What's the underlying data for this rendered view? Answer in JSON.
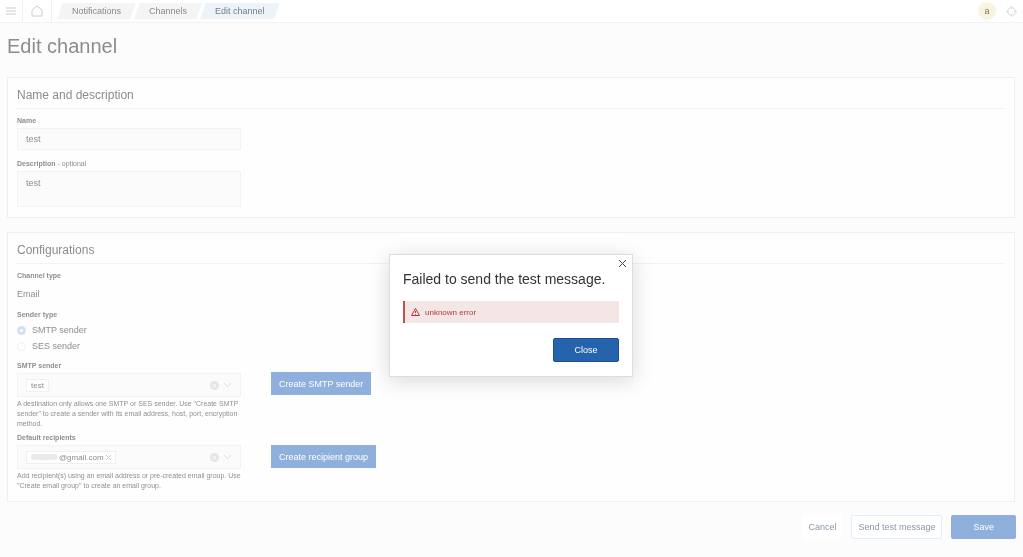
{
  "header": {
    "breadcrumbs": [
      {
        "label": "Notifications",
        "selected": false
      },
      {
        "label": "Channels",
        "selected": false
      },
      {
        "label": "Edit channel",
        "selected": true
      }
    ],
    "avatar": "a"
  },
  "title": "Edit channel",
  "name_section": {
    "title": "Name and description",
    "name_label": "Name",
    "name_value": "test",
    "description_label": "Description",
    "description_optional": "- optional",
    "description_value": "test"
  },
  "config_section": {
    "title": "Configurations",
    "channel_type_label": "Channel type",
    "channel_type_value": "Email",
    "sender_type_label": "Sender type",
    "sender_types": [
      {
        "label": "SMTP sender",
        "selected": true
      },
      {
        "label": "SES sender",
        "selected": false
      }
    ],
    "smtp_label": "SMTP sender",
    "smtp_value": "test",
    "smtp_help": "A destination only allows one SMTP or SES sender. Use \"Create SMTP sender\" to create a sender with its email address, host, port, encryption method.",
    "smtp_button": "Create SMTP sender",
    "recipients_label": "Default recipients",
    "recipient_chip": "@gmail.com",
    "recipients_help": "Add recipient(s) using an email address or pre-created email group. Use \"Create email group\" to create an email group.",
    "recipients_button": "Create recipient group"
  },
  "footer": {
    "buttons": [
      {
        "label": "Cancel",
        "kind": "link"
      },
      {
        "label": "Send test message",
        "kind": "outline"
      },
      {
        "label": "Save",
        "kind": "primary"
      }
    ]
  },
  "modal": {
    "title": "Failed to send the test message.",
    "error": "unknown error",
    "button": "Close"
  }
}
